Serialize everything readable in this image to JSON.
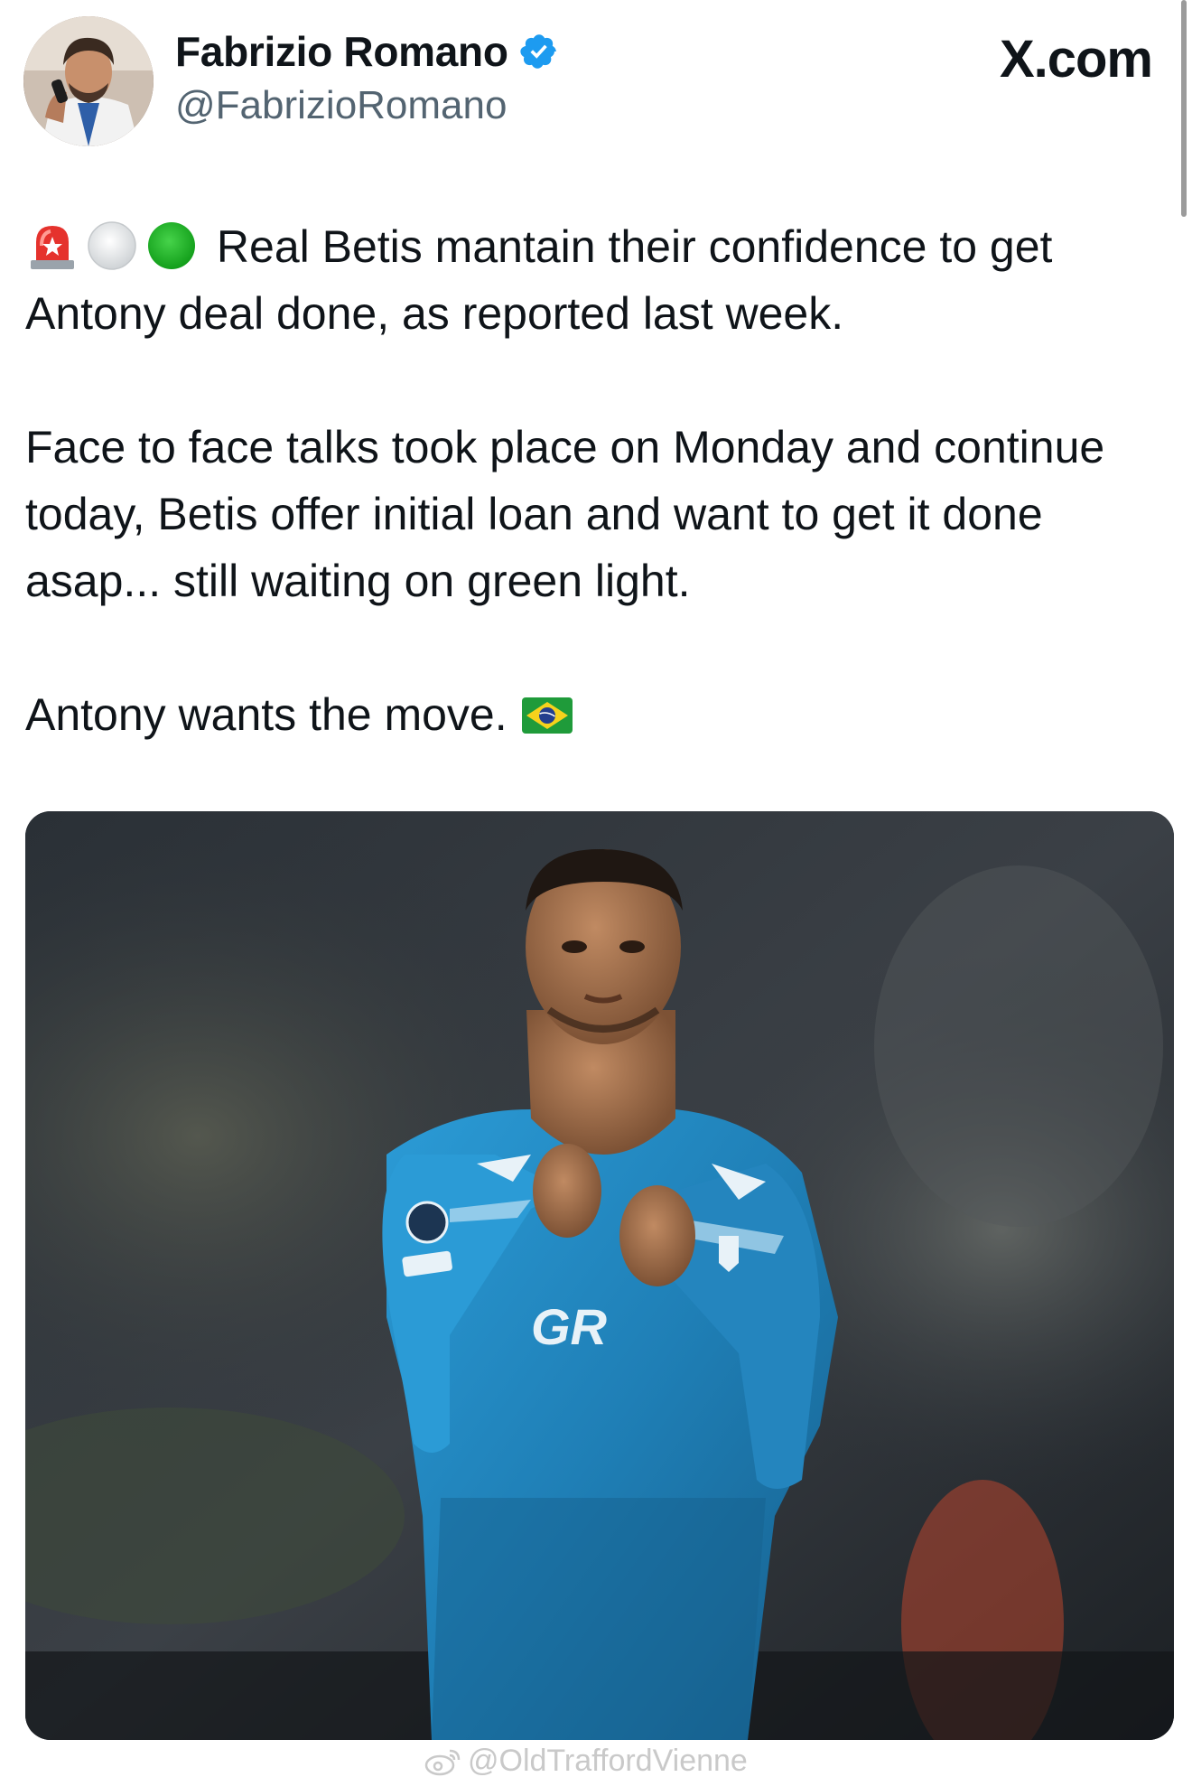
{
  "tweet": {
    "author": {
      "display_name": "Fabrizio Romano",
      "handle": "@FabrizioRomano",
      "verified": true,
      "avatar_icon": "profile-photo"
    },
    "site_label": "X.com",
    "emoji_prefix": [
      "rotating-light",
      "white-circle",
      "green-circle"
    ],
    "paragraphs": [
      "Real Betis mantain their confidence to get Antony deal done, as reported last week.",
      "Face to face talks took place on Monday and continue today, Betis offer initial loan and want to get it done asap... still waiting on green light.",
      "Antony wants the move."
    ],
    "trailing_emoji": "brazil-flag",
    "media": {
      "kind": "photo",
      "shirt_text": "GR"
    }
  },
  "watermark": {
    "icon": "weibo-icon",
    "text": "@OldTraffordVienne"
  },
  "colors": {
    "text": "#0f1419",
    "secondary": "#536471",
    "verified_blue": "#1d9bf0",
    "jersey_blue": "#1f7fb6"
  }
}
